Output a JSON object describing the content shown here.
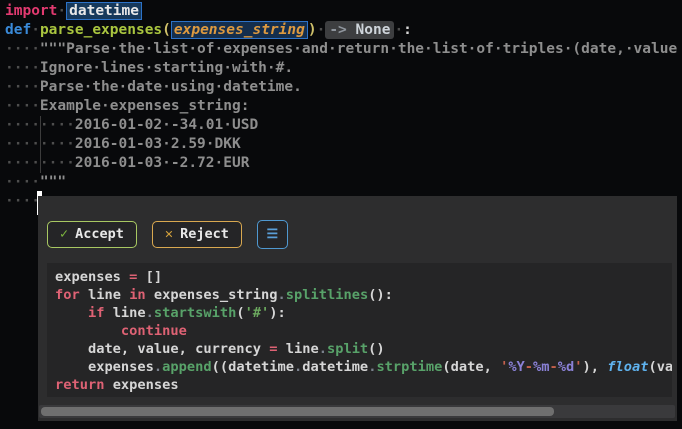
{
  "editor": {
    "lines": [
      [
        [
          "kw1",
          "import"
        ],
        [
          "ws",
          "·"
        ],
        [
          "occ",
          "datetime"
        ]
      ],
      [
        [
          "def",
          "def"
        ],
        [
          "ws",
          "·"
        ],
        [
          "fn",
          "parse_expenses"
        ],
        [
          "brkt",
          "("
        ],
        [
          "param-occ",
          "expenses_string"
        ],
        [
          "brkt",
          ")"
        ],
        [
          "ws",
          "·"
        ],
        [
          "chipa",
          "-> "
        ],
        [
          "chipb",
          "None"
        ],
        [
          "ws",
          "·"
        ],
        [
          "white",
          ":"
        ]
      ],
      [
        [
          "ws",
          "····"
        ],
        [
          "doc",
          "\"\"\"Parse·the·list·of·expenses·and·return·the·list·of·triples·(date,·value"
        ]
      ],
      [
        [
          "ws",
          "····"
        ],
        [
          "doc",
          "Ignore·lines·starting·with·#."
        ]
      ],
      [
        [
          "ws",
          "····"
        ],
        [
          "doc",
          "Parse·the·date·using·datetime."
        ]
      ],
      [
        [
          "ws",
          "····"
        ],
        [
          "doc",
          "Example·expenses_string:"
        ]
      ],
      [
        [
          "ws",
          "····"
        ],
        [
          "guide",
          ""
        ],
        [
          "ws",
          "····"
        ],
        [
          "doc",
          "2016-01-02·-34.01·USD"
        ]
      ],
      [
        [
          "ws",
          "····"
        ],
        [
          "guide",
          ""
        ],
        [
          "ws",
          "····"
        ],
        [
          "doc",
          "2016-01-03·2.59·DKK"
        ]
      ],
      [
        [
          "ws",
          "····"
        ],
        [
          "guide",
          ""
        ],
        [
          "ws",
          "····"
        ],
        [
          "doc",
          "2016-01-03·-2.72·EUR"
        ]
      ],
      [
        [
          "ws",
          "····"
        ],
        [
          "doc",
          "\"\"\""
        ]
      ],
      [
        [
          "ws",
          "····"
        ]
      ]
    ]
  },
  "panel": {
    "buttons": {
      "accept": {
        "icon": "✓",
        "label": "Accept",
        "accent": "#a8c862"
      },
      "reject": {
        "icon": "✕",
        "label": "Reject",
        "accent": "#d9a850"
      },
      "menu": {
        "icon": "☰",
        "accent": "#4f98d0"
      }
    },
    "suggestion": {
      "lines": [
        [
          [
            "id",
            "expenses "
          ],
          [
            "kw",
            "="
          ],
          [
            "id",
            " []"
          ]
        ],
        [
          [
            "kw",
            "for"
          ],
          [
            "id",
            " line "
          ],
          [
            "kw",
            "in"
          ],
          [
            "id",
            " expenses_string"
          ],
          [
            "dot",
            "."
          ],
          [
            "meth",
            "splitlines"
          ],
          [
            "id",
            "():"
          ]
        ],
        [
          [
            "id",
            "    "
          ],
          [
            "kw",
            "if"
          ],
          [
            "id",
            " line"
          ],
          [
            "dot",
            "."
          ],
          [
            "meth",
            "startswith"
          ],
          [
            "id",
            "("
          ],
          [
            "str",
            "'#'"
          ],
          [
            "id",
            "):"
          ]
        ],
        [
          [
            "kw",
            "        continue"
          ]
        ],
        [
          [
            "id",
            "    date, value, currency "
          ],
          [
            "kw",
            "="
          ],
          [
            "id",
            " line"
          ],
          [
            "dot",
            "."
          ],
          [
            "meth",
            "split"
          ],
          [
            "id",
            "()"
          ]
        ],
        [
          [
            "id",
            "    expenses"
          ],
          [
            "dot",
            "."
          ],
          [
            "meth",
            "append"
          ],
          [
            "id",
            "((datetime"
          ],
          [
            "dot",
            "."
          ],
          [
            "id",
            "datetime"
          ],
          [
            "dot",
            "."
          ],
          [
            "meth",
            "strptime"
          ],
          [
            "id",
            "(date, "
          ],
          [
            "strf",
            "'"
          ],
          [
            "esc",
            "%Y"
          ],
          [
            "strf",
            "-"
          ],
          [
            "esc",
            "%m"
          ],
          [
            "strf",
            "-"
          ],
          [
            "esc",
            "%d"
          ],
          [
            "strf",
            "'"
          ],
          [
            "id",
            "), "
          ],
          [
            "type",
            "float"
          ],
          [
            "id",
            "(val"
          ]
        ],
        [
          [
            "kw",
            "return"
          ],
          [
            "id",
            " expenses"
          ]
        ]
      ]
    }
  }
}
